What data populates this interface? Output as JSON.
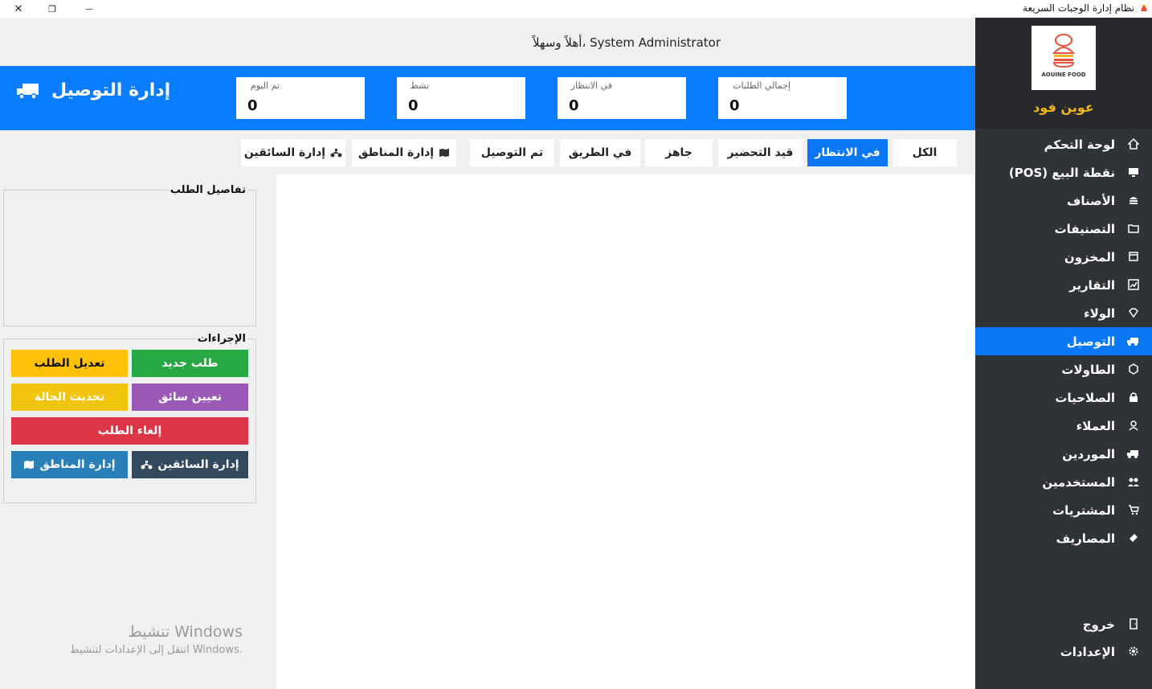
{
  "window": {
    "title": "نظام إدارة الوجبات السريعة",
    "close_glyph": "✕",
    "maximize_glyph": "❐",
    "minimize_glyph": "—"
  },
  "sidebar": {
    "logo_text": "AOUINE FOOD",
    "brand": "عوين فود",
    "items": [
      {
        "label": "لوحة التحكم",
        "icon": "home-icon"
      },
      {
        "label": "نقطة البيع (POS)",
        "icon": "monitor-icon"
      },
      {
        "label": "الأصناف",
        "icon": "burger-icon"
      },
      {
        "label": "التصنيفات",
        "icon": "folder-icon"
      },
      {
        "label": "المخزون",
        "icon": "box-icon"
      },
      {
        "label": "التقارير",
        "icon": "chart-icon"
      },
      {
        "label": "الولاء",
        "icon": "diamond-icon"
      },
      {
        "label": "التوصيل",
        "icon": "truck-icon"
      },
      {
        "label": "الطاولات",
        "icon": "table-icon"
      },
      {
        "label": "الصلاحيات",
        "icon": "lock-icon"
      },
      {
        "label": "العملاء",
        "icon": "user-icon"
      },
      {
        "label": "الموردين",
        "icon": "truck-icon"
      },
      {
        "label": "المستخدمين",
        "icon": "users-icon"
      },
      {
        "label": "المشتريات",
        "icon": "cart-icon"
      },
      {
        "label": "المصاريف",
        "icon": "money-icon"
      }
    ],
    "logout": "خروج",
    "settings": "الإعدادات"
  },
  "header": {
    "welcome": "أهلاً وسهلاً، System Administrator",
    "page_title": "إدارة التوصيل"
  },
  "stats": [
    {
      "label": "إجمالي الطلبات",
      "value": "0"
    },
    {
      "label": "في الانتظار",
      "value": "0"
    },
    {
      "label": "نشط",
      "value": "0"
    },
    {
      "label": "تم اليوم",
      "value": "0"
    }
  ],
  "tabs": [
    {
      "label": "الكل"
    },
    {
      "label": "في الانتظار"
    },
    {
      "label": "قيد التحضير"
    },
    {
      "label": "جاهز"
    },
    {
      "label": "في الطريق"
    },
    {
      "label": "تم التوصيل"
    },
    {
      "label": "إدارة المناطق"
    },
    {
      "label": "إدارة السائقين"
    }
  ],
  "details": {
    "title": "تفاصيل الطلب"
  },
  "actions": {
    "title": "الإجراءات",
    "new_order": "طلب جديد",
    "edit_order": "تعديل الطلب",
    "assign_driver": "تعيين سائق",
    "update_status": "تحديث الحالة",
    "cancel_order": "إلغاء الطلب",
    "manage_drivers": "إدارة السائقين",
    "manage_zones": "إدارة المناطق"
  },
  "watermark": {
    "line1": "تنشيط Windows",
    "line2": "انتقل إلى الإعدادات لتنشيط Windows."
  },
  "colors": {
    "accent": "#0a78f5",
    "sidebar": "#2f3236",
    "brand": "#f1b51c",
    "green": "#28a745",
    "yellow": "#ffc107",
    "purple": "#9b59b6",
    "red": "#dc3545",
    "navy": "#34495e",
    "blue": "#2980b9"
  }
}
